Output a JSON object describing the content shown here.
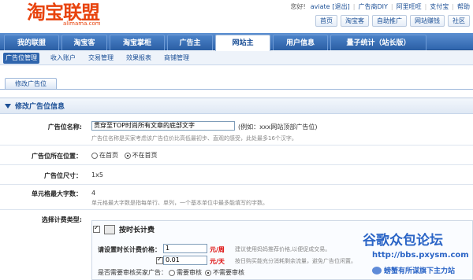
{
  "header": {
    "logo_text": "淘宝联盟",
    "logo_sub": "alimama.com",
    "user_text": "您好!",
    "username": "aviate",
    "logout": "[退出]",
    "top_links": [
      "广告商DIY",
      "阿里旺旺",
      "支付宝",
      "帮助"
    ],
    "quick_buttons": [
      "首页",
      "淘宝客",
      "自助推广",
      "网站赚钱",
      "社区"
    ]
  },
  "nav": {
    "tabs": [
      "我的联盟",
      "淘宝客",
      "淘宝掌柜",
      "广告主",
      "网站主",
      "用户信息",
      "量子统计（站长版）"
    ],
    "active_tab": "网站主"
  },
  "subnav": {
    "items": [
      "广告位管理",
      "收入账户",
      "交易管理",
      "效果报表",
      "商铺管理"
    ],
    "active": "广告位管理"
  },
  "page_tab": "修改广告位",
  "panel": {
    "title": "修改广告位信息",
    "fields": {
      "name_label": "广告位名称:",
      "name_value": "贯穿至TOP时尚所有文章的底部文字",
      "name_example": "(例如：xxx网站顶部广告位)",
      "name_hint": "广告位名称是买家考虑该广告位价比高低最初步、直观的感受，此处最多16个汉字。",
      "position_label": "广告位所在位置：",
      "position_options": [
        "在首页",
        "不在首页"
      ],
      "position_selected": "不在首页",
      "size_label": "广告位尺寸：",
      "size_value": "1x5",
      "units_label": "单元格最大字数：",
      "units_value": "4",
      "units_hint": "单元格最大字数是指每单行、单列，一个基本单位中最多能填写的字数。",
      "billing_label": "选择计费类型:",
      "billing_option": "按时长计费",
      "price_label": "请设置时长计费价格：",
      "price_value": "1",
      "price_unit": "元/周",
      "price_hint": "建议使用妈妈推荐价格,以便促成交易。",
      "day_value": "0.01",
      "day_unit": "元/天",
      "day_hint": "按日购买能充分消耗剩余流量，避免广告位闲置。",
      "review_label": "是否需要审核买家广告：",
      "review_options": [
        "需要审核",
        "不需要审核"
      ],
      "review_selected": "不需要审核"
    }
  },
  "watermark": {
    "line1": "谷歌众包论坛",
    "line2": "http://bbs.pxysm.com",
    "line3": "螃蟹有所谋旗下主力站"
  }
}
